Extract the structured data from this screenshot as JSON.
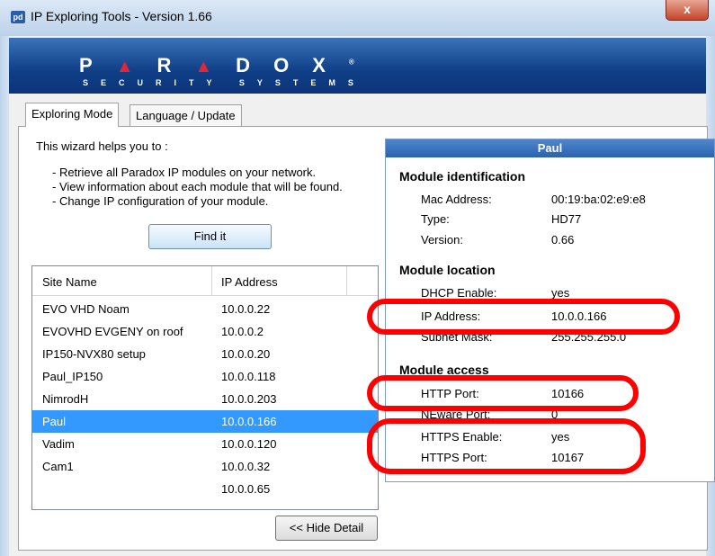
{
  "window": {
    "title": "IP Exploring Tools - Version 1.66",
    "app_icon": "pd",
    "close_label": "x"
  },
  "banner": {
    "brand": [
      "P",
      "▲",
      "R",
      "▲",
      "D",
      "O",
      "X"
    ],
    "brand_mark": "®",
    "tagline": "SECURITY SYSTEMS"
  },
  "tabs": [
    {
      "label": "Exploring Mode",
      "active": true
    },
    {
      "label": "Language / Update",
      "active": false
    }
  ],
  "wizard": {
    "intro": "This wizard helps you to :",
    "bullets": [
      "- Retrieve all Paradox IP modules on your network.",
      "- View information about each module that will be found.",
      "- Change IP configuration of your module."
    ],
    "find_button": "Find it"
  },
  "site_list": {
    "columns": [
      "Site Name",
      "IP Address"
    ],
    "rows": [
      {
        "name": "EVO VHD Noam",
        "ip": "10.0.0.22"
      },
      {
        "name": "EVOVHD EVGENY on roof",
        "ip": "10.0.0.2"
      },
      {
        "name": "IP150-NVX80 setup",
        "ip": "10.0.0.20"
      },
      {
        "name": "Paul_IP150",
        "ip": "10.0.0.118"
      },
      {
        "name": "NimrodH",
        "ip": "10.0.0.203"
      },
      {
        "name": "Paul",
        "ip": "10.0.0.166"
      },
      {
        "name": "Vadim",
        "ip": "10.0.0.120"
      },
      {
        "name": "Cam1",
        "ip": "10.0.0.32"
      },
      {
        "name": "",
        "ip": "10.0.0.65"
      }
    ],
    "selected_index": 5
  },
  "hide_detail_button": "<< Hide Detail",
  "detail": {
    "title": "Paul",
    "identification": {
      "heading": "Module identification",
      "fields": [
        {
          "label": "Mac Address:",
          "value": "00:19:ba:02:e9:e8"
        },
        {
          "label": "Type:",
          "value": "HD77"
        },
        {
          "label": "Version:",
          "value": "0.66"
        }
      ]
    },
    "location": {
      "heading": "Module location",
      "fields": [
        {
          "label": "DHCP Enable:",
          "value": "yes"
        },
        {
          "label": "IP Address:",
          "value": "10.0.0.166"
        },
        {
          "label": "Subnet Mask:",
          "value": "255.255.255.0"
        }
      ]
    },
    "access": {
      "heading": "Module access",
      "fields": [
        {
          "label": "HTTP Port:",
          "value": "10166"
        },
        {
          "label": "NEware Port:",
          "value": "0"
        },
        {
          "label": "HTTPS Enable:",
          "value": "yes"
        },
        {
          "label": "HTTPS Port:",
          "value": "10167"
        }
      ]
    }
  },
  "colors": {
    "highlight": "#ff0000",
    "selection": "#3399ff",
    "banner": "#0f3f86",
    "brand_accent": "#e32636"
  }
}
